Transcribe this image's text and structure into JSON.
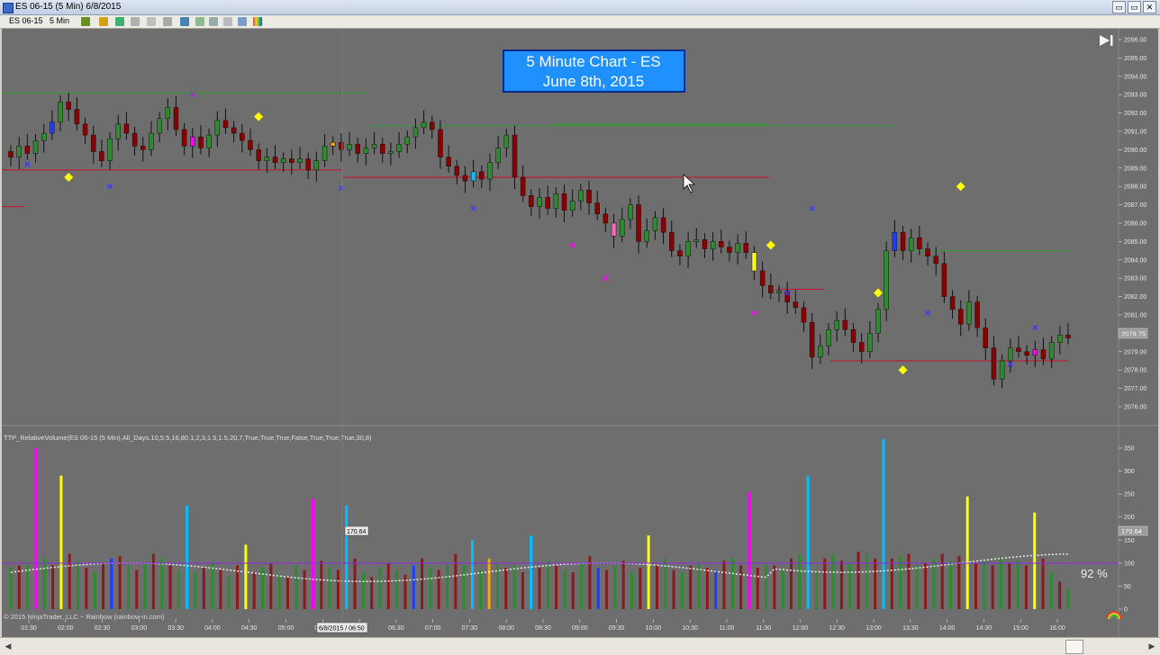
{
  "window": {
    "title": "ES 06-15 (5 Min)  6/8/2015",
    "controls": [
      "▭",
      "▭",
      "✕"
    ]
  },
  "toolbar": {
    "instrument": "ES 06-15",
    "interval": "5 Min"
  },
  "title_box": {
    "line1": "5 Minute Chart - ES",
    "line2": "June 8th, 2015"
  },
  "indicator_label": "TTP_RelativeVolume(ES 06-15 (5 Min),All_Days,10,5,5,16,80,1,2,3,1.5,1.5,20,7,True,True,True,False,True,True,True,30,8)",
  "copyright": "© 2015 NinjaTrader, LLC ~ Rainbow (rainbow-in.com)",
  "percent_label": "92 %",
  "price_marker": "2079.75",
  "volume_marker": "170.64",
  "volume_cursor_label": "170.64",
  "time_cursor_label": "6/8/2015 / 06:50",
  "colors": {
    "background": "#6e6e6e",
    "up": "#2e8b2e",
    "down": "#8b0000",
    "signal": "#ffff00"
  },
  "chart_data": {
    "type": "candlestick",
    "price_axis": {
      "ticks": [
        "2096.00",
        "2095.00",
        "2094.00",
        "2093.00",
        "2092.00",
        "2091.00",
        "2090.00",
        "2089.00",
        "2088.00",
        "2087.00",
        "2086.00",
        "2085.00",
        "2084.00",
        "2083.00",
        "2082.00",
        "2081.00",
        "2080.00",
        "2079.00",
        "2078.00",
        "2077.00",
        "2076.00"
      ],
      "range": [
        2075.25,
        2096.25
      ]
    },
    "volume_axis": {
      "ticks": [
        "350",
        "300",
        "250",
        "200",
        "150",
        "100",
        "50",
        "0"
      ],
      "range": [
        0,
        375
      ]
    },
    "time_axis": {
      "labels": [
        "01:30",
        "02:00",
        "02:30",
        "03:00",
        "03:30",
        "04:00",
        "04:30",
        "05:00",
        "05:30",
        "06:00",
        "06:30",
        "07:00",
        "07:30",
        "08:00",
        "08:30",
        "09:00",
        "09:30",
        "10:00",
        "10:30",
        "11:00",
        "11:30",
        "12:00",
        "12:30",
        "13:00",
        "13:30",
        "14:00",
        "14:30",
        "15:00",
        "16:00"
      ]
    },
    "last_price": 2079.75,
    "volume_average": 100,
    "price_path": [
      2089.6,
      2090.2,
      2089.8,
      2090.5,
      2090.9,
      2091.5,
      2092.6,
      2092.2,
      2091.4,
      2090.8,
      2089.9,
      2089.4,
      2090.6,
      2091.4,
      2090.9,
      2090.2,
      2090.0,
      2090.9,
      2091.7,
      2092.3,
      2091.1,
      2090.2,
      2090.7,
      2090.1,
      2090.8,
      2091.6,
      2091.2,
      2090.9,
      2090.5,
      2090.0,
      2089.4,
      2089.6,
      2089.3,
      2089.5,
      2089.3,
      2089.5,
      2088.9,
      2089.4,
      2090.2,
      2090.4,
      2090.0,
      2090.3,
      2089.8,
      2090.1,
      2090.3,
      2089.8,
      2089.9,
      2090.3,
      2090.7,
      2091.2,
      2091.5,
      2091.1,
      2089.6,
      2089.1,
      2088.6,
      2088.3,
      2088.8,
      2088.4,
      2089.3,
      2090.1,
      2090.8,
      2088.5,
      2087.5,
      2086.9,
      2087.4,
      2086.8,
      2087.6,
      2086.7,
      2087.2,
      2087.8,
      2087.1,
      2086.5,
      2086.0,
      2085.3,
      2086.2,
      2087.0,
      2085.0,
      2085.6,
      2086.3,
      2085.5,
      2084.5,
      2084.2,
      2085.0,
      2085.1,
      2084.6,
      2085.0,
      2084.7,
      2084.4,
      2084.9,
      2084.4,
      2083.4,
      2082.6,
      2082.2,
      2082.3,
      2081.7,
      2081.4,
      2080.6,
      2078.7,
      2079.3,
      2080.2,
      2080.7,
      2080.2,
      2079.5,
      2079.0,
      2080.0,
      2081.3,
      2084.5,
      2085.5,
      2084.5,
      2085.2,
      2084.6,
      2084.2,
      2083.8,
      2082.0,
      2081.3,
      2080.5,
      2081.7,
      2080.3,
      2079.2,
      2077.5,
      2078.5,
      2079.2,
      2079.0,
      2078.8,
      2079.1,
      2078.6,
      2079.5,
      2079.9,
      2079.75
    ],
    "volume_values": [
      90,
      95,
      100,
      80,
      110,
      95,
      85,
      120,
      105,
      90,
      80,
      100,
      110,
      115,
      95,
      85,
      100,
      120,
      110,
      95,
      85,
      75,
      80,
      90,
      100,
      85,
      70,
      95,
      105,
      80,
      90,
      100,
      75,
      70,
      95,
      85,
      80,
      105,
      90,
      85,
      95,
      110,
      80,
      70,
      90,
      100,
      85,
      75,
      95,
      110,
      90,
      85,
      100,
      120,
      95,
      80,
      85,
      110,
      100,
      90,
      95,
      80,
      75,
      90,
      105,
      95,
      85,
      80,
      100,
      115,
      90,
      85,
      95,
      105,
      80,
      90,
      100,
      95,
      110,
      85,
      80,
      95,
      100,
      90,
      85,
      105,
      110,
      95,
      80,
      90,
      100,
      95,
      85,
      110,
      120,
      90,
      85,
      110,
      120,
      105,
      100,
      125,
      120,
      110,
      100,
      110,
      115,
      120,
      95,
      100,
      110,
      120,
      105,
      115,
      110,
      100,
      105,
      95,
      110,
      100,
      105,
      95,
      120,
      110,
      80,
      60,
      45
    ]
  }
}
